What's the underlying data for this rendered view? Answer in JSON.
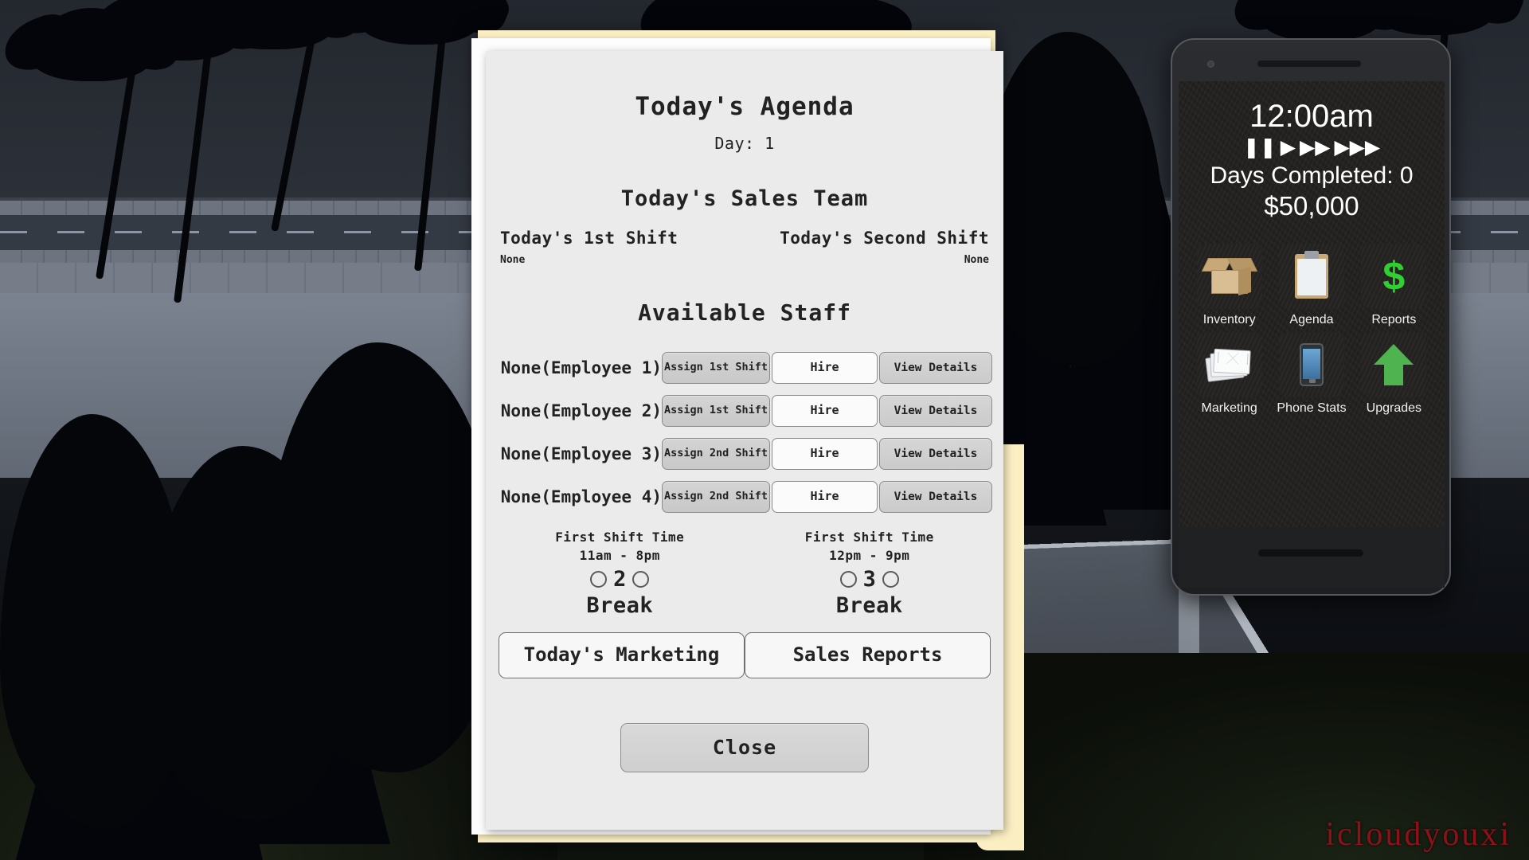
{
  "agenda": {
    "title": "Today's Agenda",
    "day_label": "Day: 1",
    "sales_team_heading": "Today's Sales Team",
    "shift_columns": [
      {
        "title": "Today's 1st Shift",
        "value": "None"
      },
      {
        "title": "Today's Second Shift",
        "value": "None"
      }
    ],
    "available_staff_heading": "Available Staff",
    "employees": [
      {
        "name": "None(Employee 1)",
        "assign_label": "Assign 1st Shift",
        "hire_label": "Hire",
        "details_label": "View Details"
      },
      {
        "name": "None(Employee 2)",
        "assign_label": "Assign 1st Shift",
        "hire_label": "Hire",
        "details_label": "View Details"
      },
      {
        "name": "None(Employee 3)",
        "assign_label": "Assign 2nd Shift",
        "hire_label": "Hire",
        "details_label": "View Details"
      },
      {
        "name": "None(Employee 4)",
        "assign_label": "Assign 2nd Shift",
        "hire_label": "Hire",
        "details_label": "View Details"
      }
    ],
    "shift_times": [
      {
        "title": "First Shift Time",
        "range": "11am - 8pm",
        "break_count": "2",
        "break_label": "Break"
      },
      {
        "title": "First Shift Time",
        "range": "12pm - 9pm",
        "break_count": "3",
        "break_label": "Break"
      }
    ],
    "marketing_button": "Today's Marketing",
    "reports_button": "Sales Reports",
    "close_button": "Close"
  },
  "phone": {
    "clock": "12:00am",
    "speed_controls": [
      {
        "icon": "pause-icon",
        "glyph": "❚❚"
      },
      {
        "icon": "play-icon",
        "glyph": "▶"
      },
      {
        "icon": "fast-forward-icon",
        "glyph": "▶▶"
      },
      {
        "icon": "very-fast-forward-icon",
        "glyph": "▶▶▶"
      }
    ],
    "days_completed": "Days Completed: 0",
    "money": "$50,000",
    "apps": [
      {
        "label": "Inventory",
        "icon": "box-icon"
      },
      {
        "label": "Agenda",
        "icon": "clipboard-icon"
      },
      {
        "label": "Reports",
        "icon": "dollar-icon"
      },
      {
        "label": "Marketing",
        "icon": "envelopes-icon"
      },
      {
        "label": "Phone Stats",
        "icon": "smartphone-icon"
      },
      {
        "label": "Upgrades",
        "icon": "up-arrow-icon"
      }
    ]
  },
  "watermark": {
    "text": "icloudyouxi"
  },
  "colors": {
    "folder": "#faeec2",
    "paper": "#ebebeb",
    "accent_green": "#2fd02f",
    "watermark_red": "#8f1118"
  }
}
